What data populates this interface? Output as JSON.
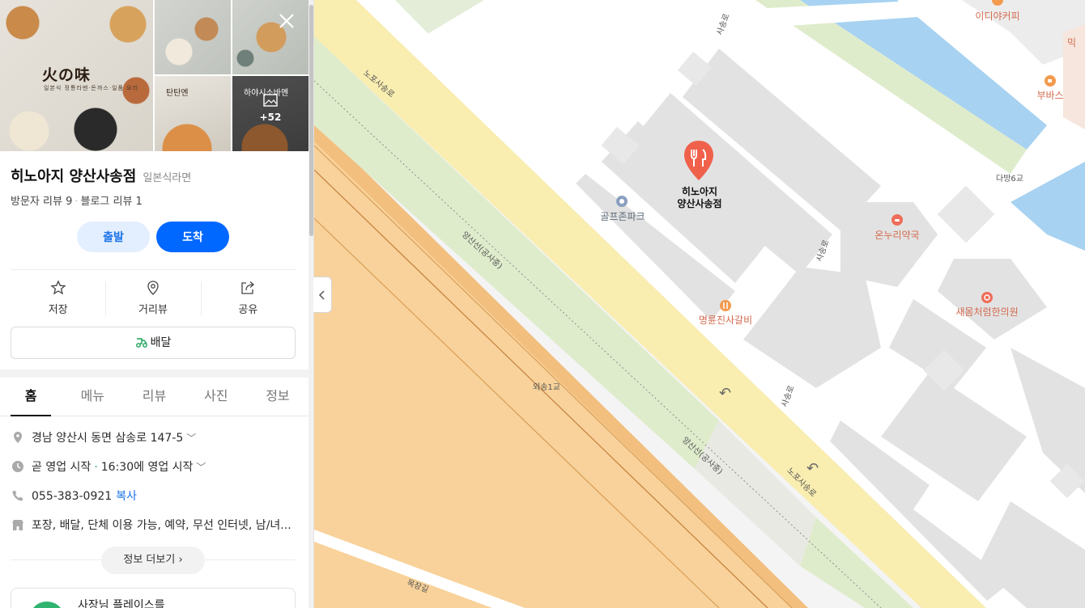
{
  "place": {
    "name": "히노아지 양산사송점",
    "category": "일본식라면",
    "visitor_reviews": "방문자 리뷰 9",
    "blog_reviews": "블로그 리뷰 1",
    "photo_count": "+52",
    "brand_text": "火の味",
    "brand_sub": "일본식 정통라멘·돈까스·일품 요리",
    "photo_caption_1": "탄탄멘",
    "photo_caption_2": "하야시소바멘"
  },
  "buttons": {
    "depart": "출발",
    "arrive": "도착"
  },
  "actions": [
    {
      "label": "저장",
      "icon": "star-icon"
    },
    {
      "label": "거리뷰",
      "icon": "location-pin-icon"
    },
    {
      "label": "공유",
      "icon": "share-icon"
    }
  ],
  "delivery": "배달",
  "tabs": [
    "홈",
    "메뉴",
    "리뷰",
    "사진",
    "정보"
  ],
  "info": {
    "address": "경남 양산시 동면 삼송로 147-5",
    "hours_status": "곧 영업 시작",
    "hours_detail": "16:30에 영업 시작",
    "phone": "055-383-0921",
    "copy": "복사",
    "amenities": "포장, 배달, 단체 이용 가능, 예약, 무선 인터넷, 남/녀...",
    "more_info": "정보 더보기",
    "owner_card": "사장님 플레이스를"
  },
  "map": {
    "pois": {
      "hinoaji_line1": "히노아지",
      "hinoaji_line2": "양산사송점",
      "golfzon": "골프존파크",
      "pharmacy": "온누리약국",
      "galbi": "명륜진사갈비",
      "clinic": "새몸처럼한의원",
      "ediya": "이디야커피",
      "bubas": "부바스"
    },
    "roads": {
      "nopo_top": "노포사송로",
      "nopo_bottom": "노포사송로",
      "line1": "양산선(공사중)",
      "line2": "양산선(공사중)",
      "oesong": "외송1교",
      "dabang": "다방6교",
      "sasong_1": "사송로",
      "sasong_2": "사송로",
      "sasong_3": "사송로",
      "mokjang": "목장길",
      "partial_mi": "믹"
    },
    "colors": {
      "arterial": "#f9edb0",
      "expressway": "#f8d29a",
      "green": "#dfeccc",
      "water": "#a7d2f1",
      "block": "#e2e2e2",
      "poi_red": "#f0614b"
    }
  }
}
